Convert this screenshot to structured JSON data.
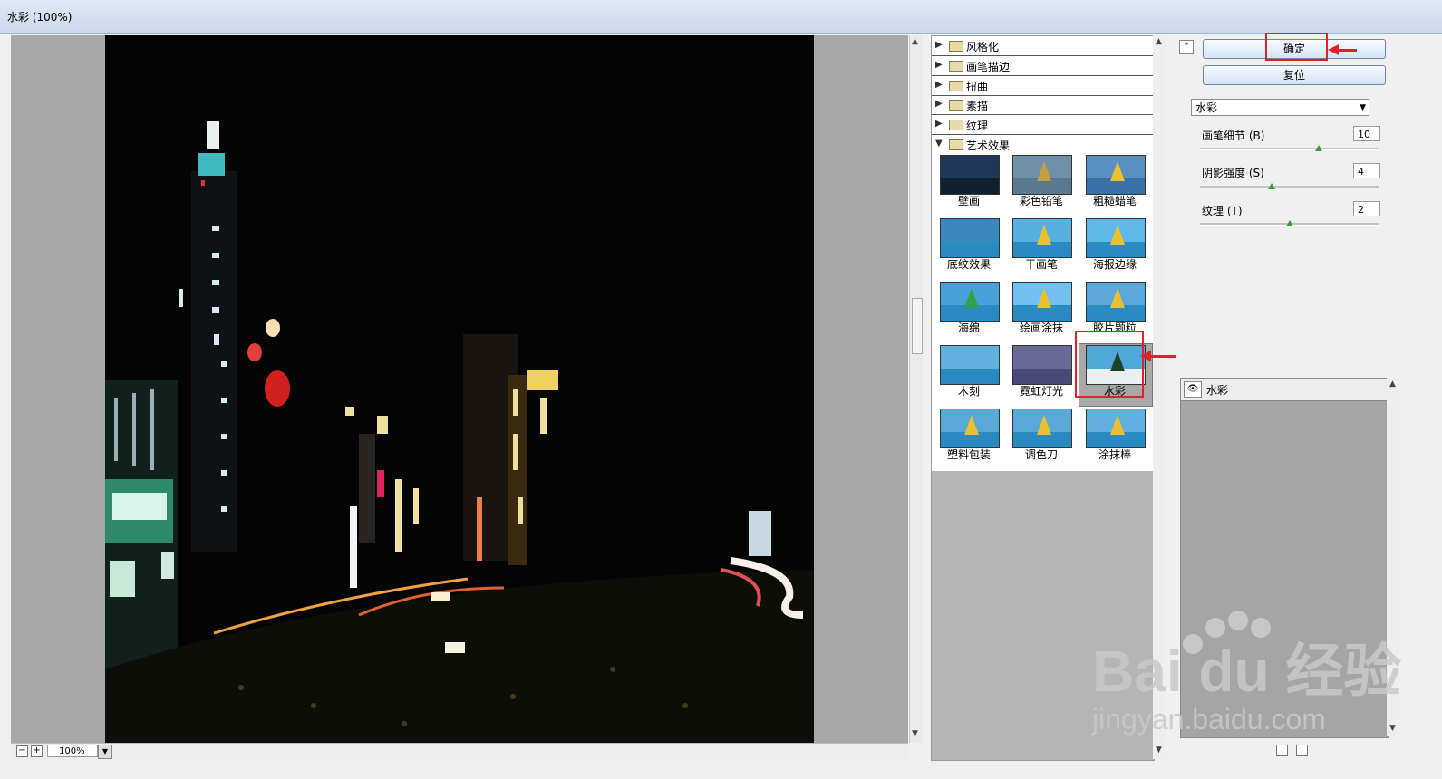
{
  "window": {
    "title": "水彩 (100%)"
  },
  "preview": {
    "zoom": "100%",
    "zoom_out_icon": "minus-icon",
    "zoom_in_icon": "plus-icon"
  },
  "gallery": {
    "categories": [
      {
        "label": "风格化",
        "expanded": false
      },
      {
        "label": "画笔描边",
        "expanded": false
      },
      {
        "label": "扭曲",
        "expanded": false
      },
      {
        "label": "素描",
        "expanded": false
      },
      {
        "label": "纹理",
        "expanded": false
      },
      {
        "label": "艺术效果",
        "expanded": true
      }
    ],
    "filters": [
      "壁画",
      "彩色铅笔",
      "粗糙蜡笔",
      "底纹效果",
      "干画笔",
      "海报边缘",
      "海绵",
      "绘画涂抹",
      "胶片颗粒",
      "木刻",
      "霓虹灯光",
      "水彩",
      "塑料包装",
      "调色刀",
      "涂抹棒"
    ],
    "selected": "水彩"
  },
  "buttons": {
    "ok": "确定",
    "reset": "复位"
  },
  "filter_select": {
    "value": "水彩"
  },
  "params": [
    {
      "label": "画笔细节 (B)",
      "value": "10",
      "level": 0.66
    },
    {
      "label": "阴影强度 (S)",
      "value": "4",
      "level": 0.4
    },
    {
      "label": "纹理 (T)",
      "value": "2",
      "level": 0.5
    }
  ],
  "layers": [
    {
      "name": "水彩",
      "visible": true
    }
  ],
  "watermark": {
    "brand": "Bai du 经验",
    "url": "jingyan.baidu.com"
  },
  "colors": {
    "accent_red": "#e0202a",
    "panel_gray": "#a8a8a8"
  }
}
